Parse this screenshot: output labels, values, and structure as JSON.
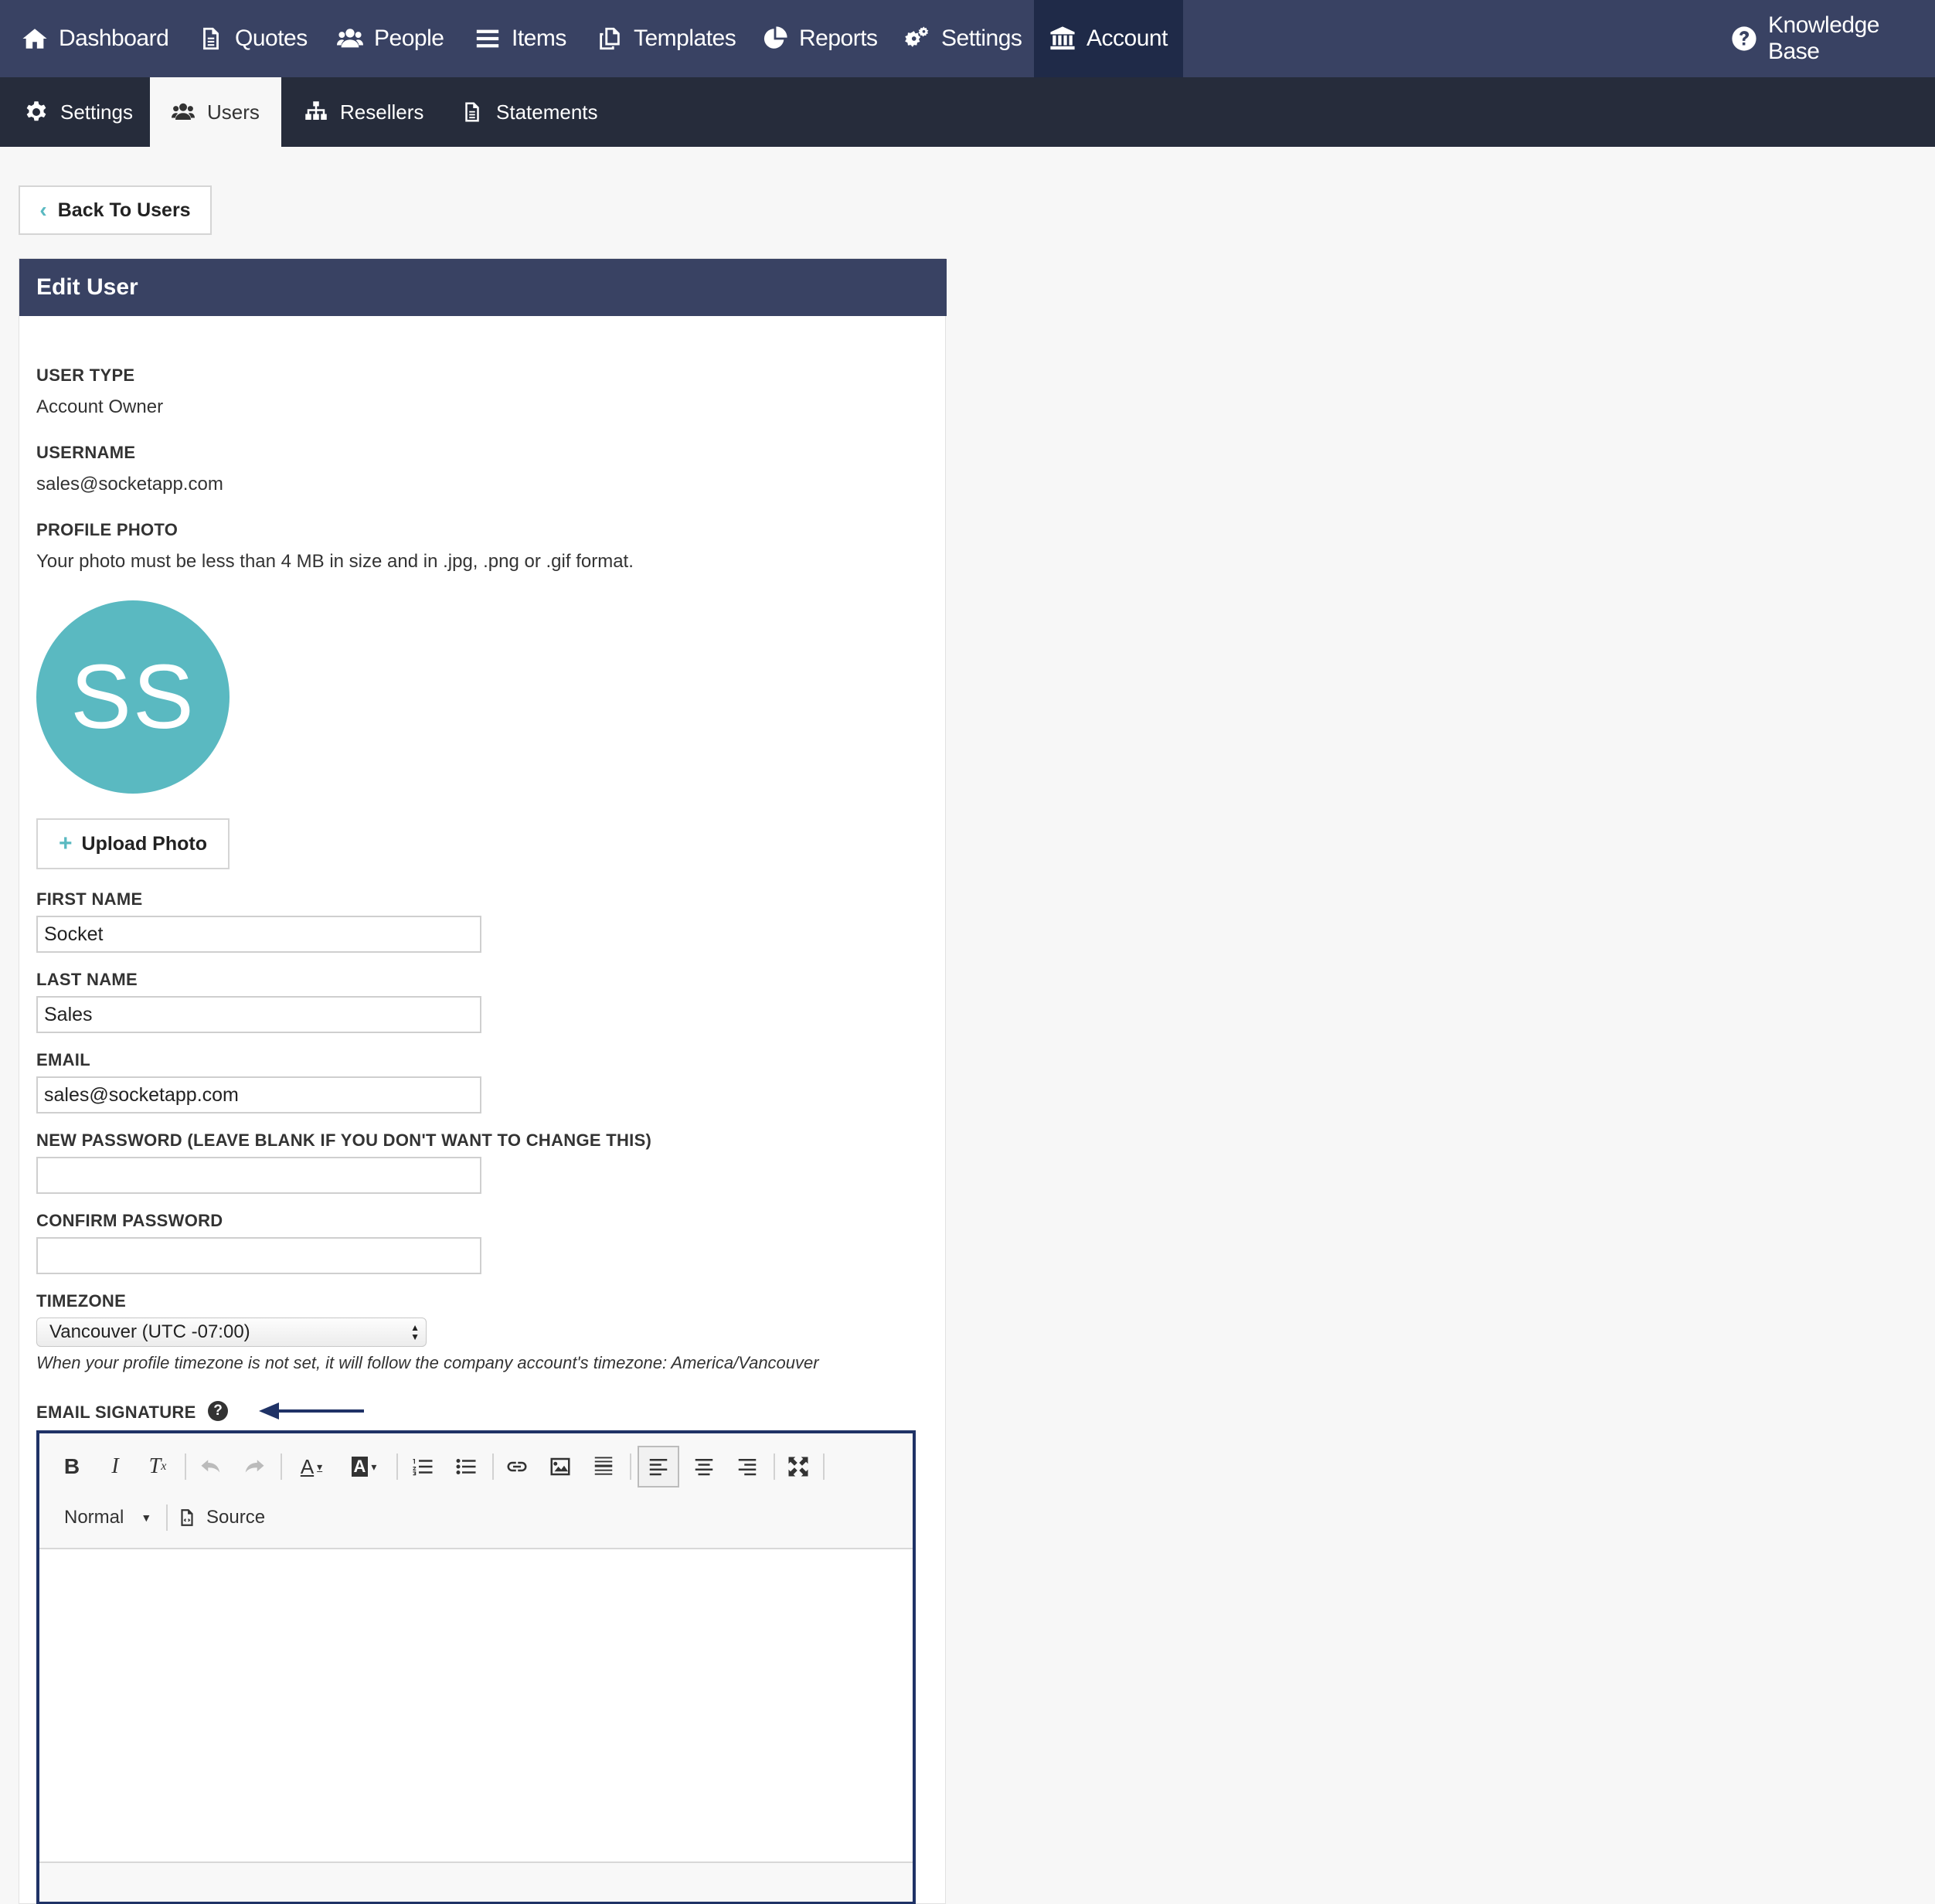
{
  "topnav": {
    "items": [
      {
        "label": "Dashboard",
        "icon": "home-icon"
      },
      {
        "label": "Quotes",
        "icon": "document-icon"
      },
      {
        "label": "People",
        "icon": "users-icon"
      },
      {
        "label": "Items",
        "icon": "list-icon"
      },
      {
        "label": "Templates",
        "icon": "copy-icon"
      },
      {
        "label": "Reports",
        "icon": "pie-chart-icon"
      },
      {
        "label": "Settings",
        "icon": "gears-icon"
      },
      {
        "label": "Account",
        "icon": "bank-icon"
      }
    ],
    "active": "Account",
    "knowledge_base": "Knowledge Base"
  },
  "subnav": {
    "items": [
      {
        "label": "Settings",
        "icon": "gear-icon"
      },
      {
        "label": "Users",
        "icon": "users-icon"
      },
      {
        "label": "Resellers",
        "icon": "sitemap-icon"
      },
      {
        "label": "Statements",
        "icon": "document-icon"
      }
    ],
    "active": "Users"
  },
  "back_button": "Back To Users",
  "panel": {
    "title": "Edit User",
    "user_type_label": "USER TYPE",
    "user_type_value": "Account Owner",
    "username_label": "USERNAME",
    "username_value": "sales@socketapp.com",
    "profile_photo_label": "PROFILE PHOTO",
    "profile_photo_hint": "Your photo must be less than 4 MB in size and in .jpg, .png or .gif format.",
    "avatar_initials": "SS",
    "upload_button": "Upload Photo",
    "first_name_label": "FIRST NAME",
    "first_name_value": "Socket",
    "last_name_label": "LAST NAME",
    "last_name_value": "Sales",
    "email_label": "EMAIL",
    "email_value": "sales@socketapp.com",
    "new_password_label": "NEW PASSWORD (LEAVE BLANK IF YOU DON'T WANT TO CHANGE THIS)",
    "new_password_value": "",
    "confirm_password_label": "CONFIRM PASSWORD",
    "confirm_password_value": "",
    "timezone_label": "TIMEZONE",
    "timezone_value": "Vancouver (UTC -07:00)",
    "timezone_hint": "When your profile timezone is not set, it will follow the company account's timezone: America/Vancouver",
    "email_signature_label": "EMAIL SIGNATURE"
  },
  "editor": {
    "format_value": "Normal",
    "source_label": "Source"
  },
  "colors": {
    "nav_bg": "#394263",
    "subnav_bg": "#262c3b",
    "accent": "#5ab9c1",
    "editor_border": "#1f3266"
  }
}
